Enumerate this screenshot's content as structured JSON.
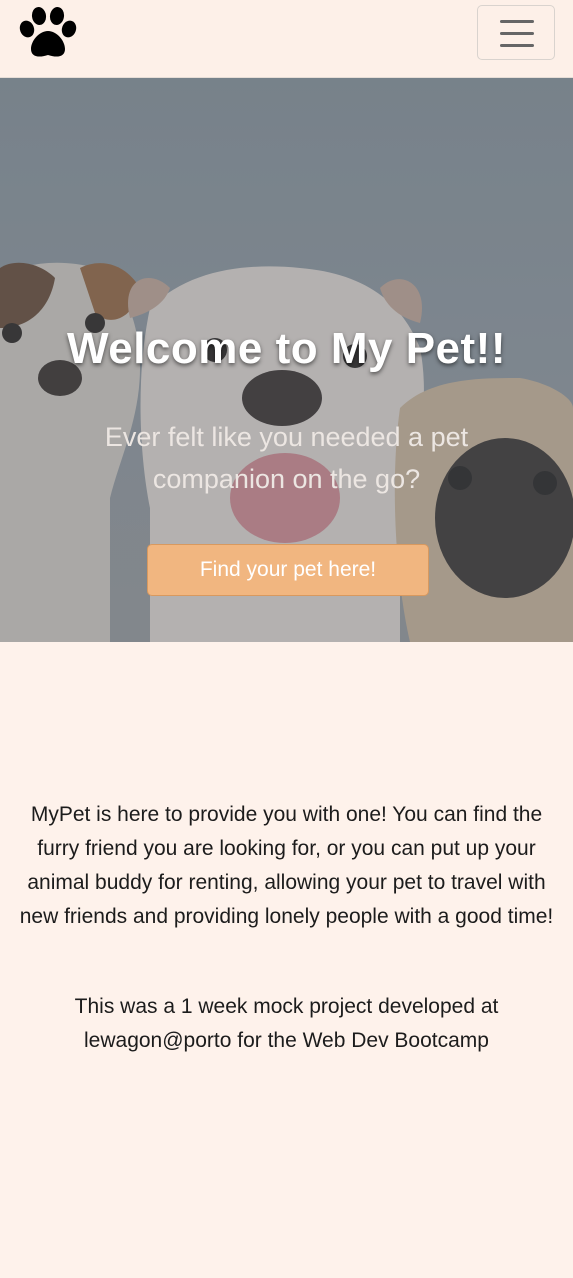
{
  "nav": {
    "logo_icon": "paw-icon",
    "menu_icon": "hamburger-menu-icon"
  },
  "hero": {
    "title": "Welcome to My Pet!!",
    "subtitle": "Ever felt like you needed a pet companion on the go?",
    "cta_label": "Find your pet here!",
    "background": "photo of a jack russell terrier, a bulldog and a pug"
  },
  "main": {
    "paragraph1": "MyPet is here to provide you with one! You can find the furry friend you are looking for, or you can put up your animal buddy for renting, allowing your pet to travel with new friends and providing lonely people with a good time!",
    "paragraph2": "This was a 1 week mock project developed at lewagon@porto for the Web Dev Bootcamp"
  },
  "colors": {
    "page_bg": "#fef2eb",
    "button": "#f1b680",
    "hero_overlay": "#7f8a93"
  }
}
